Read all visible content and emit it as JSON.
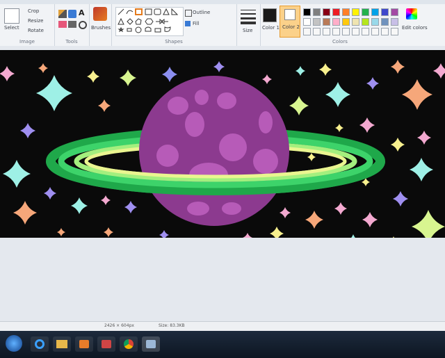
{
  "ribbon": {
    "image": {
      "select_label": "Select",
      "crop_label": "Crop",
      "resize_label": "Resize",
      "rotate_label": "Rotate",
      "group_label": "Image"
    },
    "tools": {
      "group_label": "Tools"
    },
    "brushes": {
      "label": "Brushes"
    },
    "shapes": {
      "outline_label": "Outline",
      "fill_label": "Fill",
      "group_label": "Shapes"
    },
    "size": {
      "label": "Size"
    },
    "colors": {
      "color1_label": "Color 1",
      "color2_label": "Color 2",
      "edit_label": "Edit colors",
      "group_label": "Colors",
      "color1": "#1a1a1a",
      "color2": "#ffffff",
      "palette_row1": [
        "#000000",
        "#7f7f7f",
        "#880015",
        "#ed1c24",
        "#ff7f27",
        "#fff200",
        "#22b14c",
        "#00a2e8",
        "#3f48cc",
        "#a349a4"
      ],
      "palette_row2": [
        "#ffffff",
        "#c3c3c3",
        "#b97a57",
        "#ffaec9",
        "#ffc90e",
        "#efe4b0",
        "#b5e61d",
        "#99d9ea",
        "#7092be",
        "#c8bfe7"
      ]
    }
  },
  "status": {
    "dimensions": "2426 × 604px",
    "size": "Size: 83.3KB"
  },
  "taskbar": {
    "icons": [
      "start-orb-icon",
      "ie-icon",
      "folder-icon",
      "media-icon",
      "paint-icon",
      "chrome-icon",
      "app-icon"
    ]
  }
}
